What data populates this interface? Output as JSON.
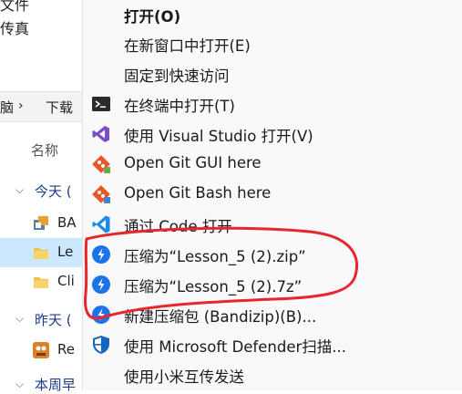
{
  "explorer": {
    "top_text_1": "文件",
    "top_text_2": "传真",
    "breadcrumb_1": "脑",
    "breadcrumb_sep": "›",
    "breadcrumb_2": "下载",
    "column_name": "名称",
    "group_today": "今天 (",
    "group_yesterday": "昨天 (",
    "group_this_week": "本周早",
    "files": [
      "BA",
      "Le",
      "Cli",
      "Re"
    ]
  },
  "menu": {
    "items": [
      {
        "label": "打开(O)"
      },
      {
        "label": "在新窗口中打开(E)"
      },
      {
        "label": "固定到快速访问"
      },
      {
        "label": "在终端中打开(T)"
      },
      {
        "label": "使用 Visual Studio 打开(V)"
      },
      {
        "label": "Open Git GUI here"
      },
      {
        "label": "Open Git Bash here"
      },
      {
        "label": "通过 Code 打开"
      },
      {
        "label": "压缩为“Lesson_5 (2).zip”"
      },
      {
        "label": "压缩为“Lesson_5 (2).7z”"
      },
      {
        "label": "新建压缩包 (Bandizip)(B)..."
      },
      {
        "label": "使用 Microsoft Defender扫描..."
      },
      {
        "label": "使用小米互传发送"
      }
    ]
  },
  "colors": {
    "highlight_circle": "#e8262e",
    "selected_row": "#cce8ff",
    "bandizip_blue": "#1a73e8",
    "vs_purple": "#7b4dc4",
    "vscode_blue": "#1e88e5",
    "git_orange": "#e8562a",
    "defender_blue": "#1565c0"
  }
}
